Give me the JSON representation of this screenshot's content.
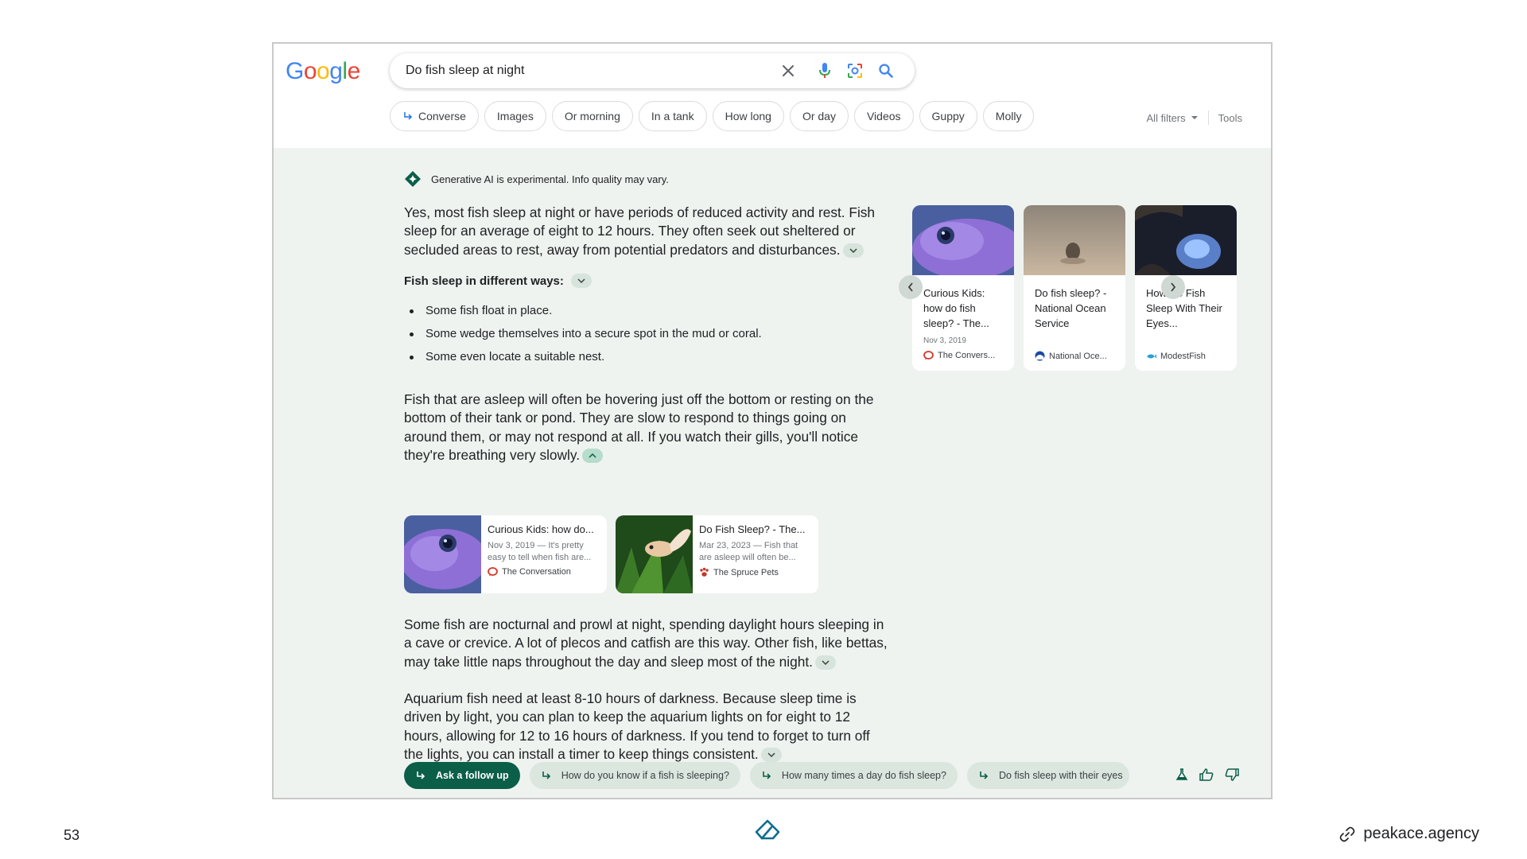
{
  "slide": {
    "page_number": "53",
    "footer_link": "peakace.agency"
  },
  "colors": {
    "google_blue": "#4285F4",
    "google_red": "#EA4335",
    "google_yellow": "#FBBC05",
    "google_green": "#34A853",
    "ai_accent": "#0b5e48",
    "ai_background": "#eff3f0"
  },
  "header": {
    "logo_letters": [
      "G",
      "o",
      "o",
      "g",
      "l",
      "e"
    ],
    "search_value": "Do fish sleep at night",
    "chips": [
      "Converse",
      "Images",
      "Or morning",
      "In a tank",
      "How long",
      "Or day",
      "Videos",
      "Guppy",
      "Molly"
    ],
    "all_filters": "All filters",
    "tools": "Tools"
  },
  "ai": {
    "experimental_note": "Generative AI is experimental. Info quality may vary.",
    "para1": "Yes, most fish sleep at night or have periods of reduced activity and rest. Fish sleep for an average of eight to 12 hours. They often seek out sheltered or secluded areas to rest, away from potential predators and disturbances.",
    "subheading": "Fish sleep in different ways:",
    "bullets": [
      "Some fish float in place.",
      "Some wedge themselves into a secure spot in the mud or coral.",
      "Some even locate a suitable nest."
    ],
    "para2": "Fish that are asleep will often be hovering just off the bottom or resting on the bottom of their tank or pond. They are slow to respond to things going on around them, or may not respond at all. If you watch their gills, you'll notice they're breathing very slowly.",
    "source_cards": [
      {
        "title": "Curious Kids: how do...",
        "snippet": "Nov 3, 2019 — It's pretty easy to tell when fish are...",
        "source": "The Conversation"
      },
      {
        "title": "Do Fish Sleep? - The...",
        "snippet": "Mar 23, 2023 — Fish that are asleep will often be...",
        "source": "The Spruce Pets"
      }
    ],
    "para3": "Some fish are nocturnal and prowl at night, spending daylight hours sleeping in a cave or crevice. A lot of plecos and catfish are this way. Other fish, like bettas, may take little naps throughout the day and sleep most of the night.",
    "para4": "Aquarium fish need at least 8-10 hours of darkness. Because sleep time is driven by light, you can plan to keep the aquarium lights on for eight to 12 hours, allowing for 12 to 16 hours of darkness. If you tend to forget to turn off the lights, you can install a timer to keep things consistent.",
    "carousel": [
      {
        "title": "Curious Kids: how do fish sleep? - The...",
        "date": "Nov 3, 2019",
        "source": "The Convers..."
      },
      {
        "title": "Do fish sleep? - National Ocean Service",
        "date": "",
        "source": "National Oce..."
      },
      {
        "title": "How Do Fish Sleep With Their Eyes...",
        "date": "",
        "source": "ModestFish"
      }
    ],
    "follow_up": {
      "primary": "Ask a follow up",
      "suggestions": [
        "How do you know if a fish is sleeping?",
        "How many times a day do fish sleep?",
        "Do fish sleep with their eyes"
      ]
    }
  }
}
